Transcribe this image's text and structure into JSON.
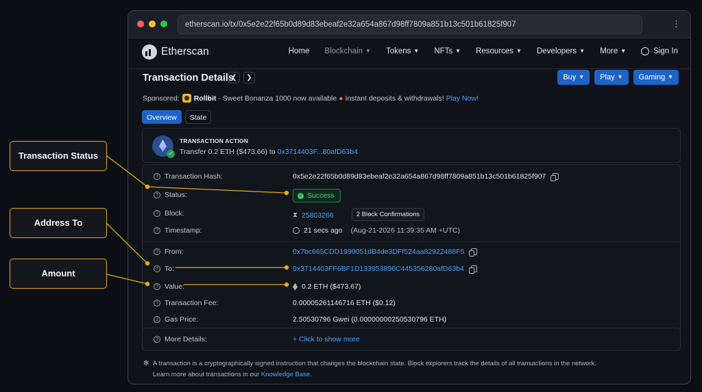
{
  "browser": {
    "url": "etherscan.io/tx/0x5e2e22f65b0d89d83ebeaf2e32a654a867d98ff7809a851b13c501b61825f907"
  },
  "nav": {
    "logo": "Etherscan",
    "items": [
      "Home",
      "Blockchain",
      "Tokens",
      "NFTs",
      "Resources",
      "Developers",
      "More"
    ],
    "sign_in": "Sign In"
  },
  "header": {
    "title": "Transaction Details",
    "buttons": [
      "Buy",
      "Play",
      "Gaming"
    ]
  },
  "sponsored": {
    "label": "Sponsored:",
    "brand": "Rollbit",
    "text1": "- Sweet Bonanza 1000 now available",
    "text2": "Instant deposits & withdrawals!",
    "cta": "Play Now!"
  },
  "tabs": [
    "Overview",
    "State"
  ],
  "action": {
    "label": "TRANSACTION ACTION",
    "text": "Transfer 0.2 ETH ($473.66) to",
    "to": "0x3714403F...80afD63b4"
  },
  "details": {
    "hash_label": "Transaction Hash:",
    "hash": "0x5e2e22f65b0d89d83ebeaf2e32a654a867d98ff7809a851b13c501b61825f907",
    "status_label": "Status:",
    "status": "Success",
    "block_label": "Block:",
    "block": "25803266",
    "confirmations": "2 Block Confirmations",
    "timestamp_label": "Timestamp:",
    "timestamp_ago": "21 secs ago",
    "timestamp_full": "(Aug-21-2026 11:39:35 AM +UTC)",
    "from_label": "From:",
    "from": "0x7bc665CDD1999051dB4de3DFf524aa82922488F5",
    "to_label": "To:",
    "to": "0x3714403FF6BF1D133953896C445356280afD63b4",
    "value_label": "Value:",
    "value": "0.2 ETH ($473.67)",
    "fee_label": "Transaction Fee:",
    "fee": "0.00005261146716 ETH ($0.12)",
    "gas_label": "Gas Price:",
    "gas": "2.50530796 Gwei (0.00000000250530796 ETH)",
    "more_label": "More Details:",
    "more_link": "+ Click to show more"
  },
  "footer": {
    "line1": "A transaction is a cryptographically signed instruction that changes the blockchain state. Block explorers track the details of all transactions in the network.",
    "line2": "Learn more about transactions in our",
    "link": "Knowledge Base",
    "end": "."
  },
  "annotations": {
    "status": "Transaction Status",
    "address_to": "Address To",
    "amount": "Amount"
  },
  "colors": {
    "accent": "#1f63c6",
    "link": "#4aa3ff",
    "annotation": "#e3ac12",
    "success": "#4fd08a"
  }
}
